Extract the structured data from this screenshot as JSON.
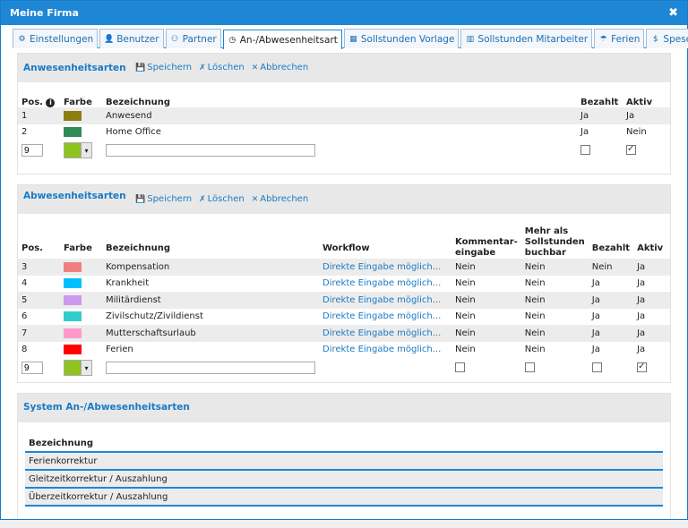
{
  "window": {
    "title": "Meine Firma"
  },
  "tabs": [
    {
      "label": "Einstellungen",
      "icon": "gear-icon"
    },
    {
      "label": "Benutzer",
      "icon": "user-icon"
    },
    {
      "label": "Partner",
      "icon": "partner-icon"
    },
    {
      "label": "An-/Abwesenheitsart",
      "icon": "clock-icon"
    },
    {
      "label": "Sollstunden Vorlage",
      "icon": "template-icon"
    },
    {
      "label": "Sollstunden Mitarbeiter",
      "icon": "bar-chart-icon"
    },
    {
      "label": "Ferien",
      "icon": "holiday-icon"
    },
    {
      "label": "Spesen",
      "icon": "money-icon"
    }
  ],
  "actions": {
    "save": "Speichern",
    "delete": "Löschen",
    "cancel": "Abbrechen"
  },
  "anwesenheit": {
    "title": "Anwesenheitsarten",
    "headers": {
      "pos": "Pos.",
      "farbe": "Farbe",
      "bezeichnung": "Bezeichnung",
      "bezahlt": "Bezahlt",
      "aktiv": "Aktiv"
    },
    "rows": [
      {
        "pos": "1",
        "color": "#8b7d10",
        "name": "Anwesend",
        "bezahlt": "Ja",
        "aktiv": "Ja"
      },
      {
        "pos": "2",
        "color": "#2e8b57",
        "name": "Home Office",
        "bezahlt": "Ja",
        "aktiv": "Nein"
      }
    ],
    "new_row": {
      "pos": "9",
      "color": "#8fc31f",
      "bezahlt": false,
      "aktiv": true
    }
  },
  "abwesenheit": {
    "title": "Abwesenheitsarten",
    "headers": {
      "pos": "Pos.",
      "farbe": "Farbe",
      "bezeichnung": "Bezeichnung",
      "workflow": "Workflow",
      "kommentar": "Kommentar-eingabe",
      "mehr": "Mehr als Sollstunden buchbar",
      "bezahlt": "Bezahlt",
      "aktiv": "Aktiv"
    },
    "rows": [
      {
        "pos": "3",
        "color": "#f08080",
        "name": "Kompensation",
        "workflow": "Direkte Eingabe möglich...",
        "kommentar": "Nein",
        "mehr": "Nein",
        "bezahlt": "Nein",
        "aktiv": "Ja"
      },
      {
        "pos": "4",
        "color": "#00bfff",
        "name": "Krankheit",
        "workflow": "Direkte Eingabe möglich...",
        "kommentar": "Nein",
        "mehr": "Nein",
        "bezahlt": "Ja",
        "aktiv": "Ja"
      },
      {
        "pos": "5",
        "color": "#cc99ee",
        "name": "Militärdienst",
        "workflow": "Direkte Eingabe möglich...",
        "kommentar": "Nein",
        "mehr": "Nein",
        "bezahlt": "Ja",
        "aktiv": "Ja"
      },
      {
        "pos": "6",
        "color": "#33cccc",
        "name": "Zivilschutz/Zivildienst",
        "workflow": "Direkte Eingabe möglich...",
        "kommentar": "Nein",
        "mehr": "Nein",
        "bezahlt": "Ja",
        "aktiv": "Ja"
      },
      {
        "pos": "7",
        "color": "#ff99cc",
        "name": "Mutterschaftsurlaub",
        "workflow": "Direkte Eingabe möglich...",
        "kommentar": "Nein",
        "mehr": "Nein",
        "bezahlt": "Ja",
        "aktiv": "Ja"
      },
      {
        "pos": "8",
        "color": "#ff0000",
        "name": "Ferien",
        "workflow": "Direkte Eingabe möglich...",
        "kommentar": "Nein",
        "mehr": "Nein",
        "bezahlt": "Ja",
        "aktiv": "Ja"
      }
    ],
    "new_row": {
      "pos": "9",
      "color": "#8fc31f",
      "kommentar": false,
      "mehr": false,
      "bezahlt": false,
      "aktiv": true
    }
  },
  "system": {
    "title": "System An-/Abwesenheitsarten",
    "header": "Bezeichnung",
    "rows": [
      "Ferienkorrektur",
      "Gleitzeitkorrektur / Auszahlung",
      "Überzeitkorrektur / Auszahlung"
    ]
  }
}
